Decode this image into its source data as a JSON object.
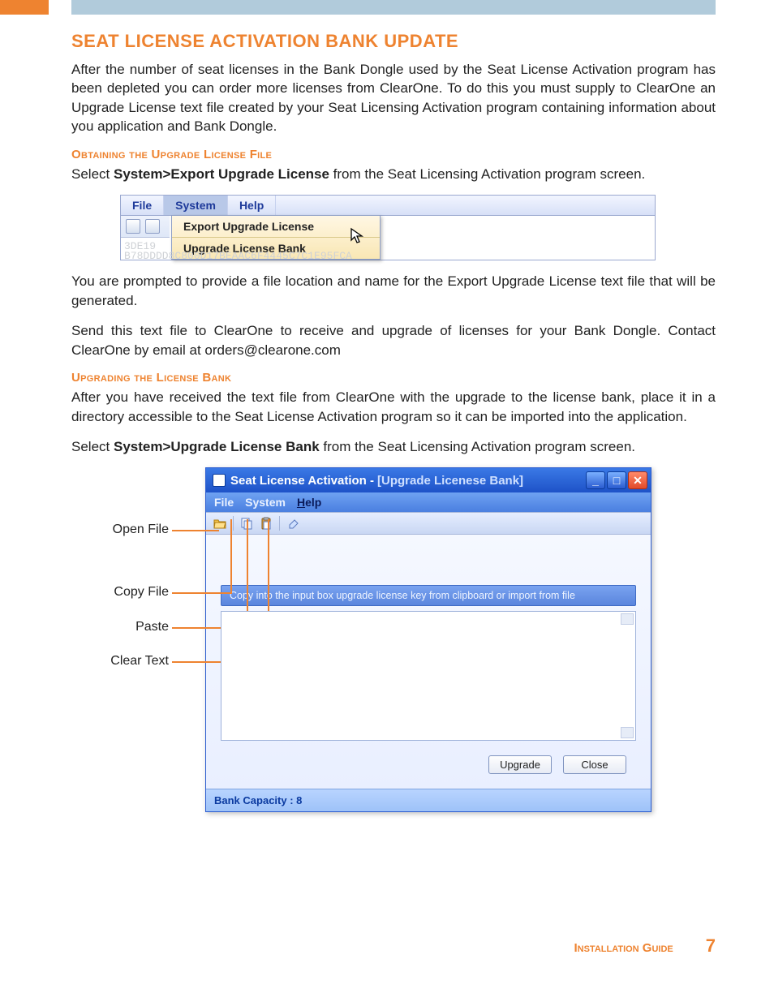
{
  "page": {
    "title": "SEAT LICENSE ACTIVATION BANK UPDATE",
    "intro": "After the number of seat licenses in the Bank Dongle used by the Seat License Activation program has been depleted you can order more licenses from ClearOne. To do this you must supply to ClearOne an Upgrade License text file created by your Seat Licensing Activation program containing information about you application and Bank Dongle.",
    "sub1": "Obtaining the Upgrade License File",
    "p1a": "Select ",
    "p1b": "System>Export Upgrade License",
    "p1c": " from the Seat Licensing Activation program screen.",
    "p2": "You are prompted to provide a file location and name for the Export Upgrade License text file that will be generated.",
    "p3": "Send this text file to ClearOne to receive and upgrade of licenses for your Bank Dongle. Contact ClearOne by email at orders@clearone.com",
    "sub2": "Upgrading the License Bank",
    "p4": "After you have received the text file from ClearOne with the upgrade to the license bank, place it in a directory accessible to the Seat License Activation program so it can be imported into the application.",
    "p5a": "Select ",
    "p5b": "System>Upgrade License Bank",
    "p5c": " from the Seat Licensing Activation program screen."
  },
  "shot1": {
    "menu": {
      "file": "File",
      "system": "System",
      "help": "Help"
    },
    "dropdown": {
      "item1": "Export Upgrade License",
      "item2": "Upgrade License Bank"
    },
    "hex1": "3DE19",
    "hex2": "B78DDDD8C800D17BEAAC6F4445C7C1E95FCA"
  },
  "callouts": {
    "open": "Open File",
    "copy": "Copy File",
    "paste": "Paste",
    "clear": "Clear Text"
  },
  "win": {
    "title_a": "Seat License Activation -",
    "title_b": "[Upgrade Licenese Bank]",
    "menu": {
      "file": "File",
      "system": "System",
      "help": "Help"
    },
    "instruction": "Copy into the input box upgrade license key from clipboard or import from file",
    "btn_upgrade": "Upgrade",
    "btn_close": "Close",
    "status": "Bank Capacity : 8"
  },
  "footer": {
    "guide": "Installation Guide",
    "page": "7"
  }
}
